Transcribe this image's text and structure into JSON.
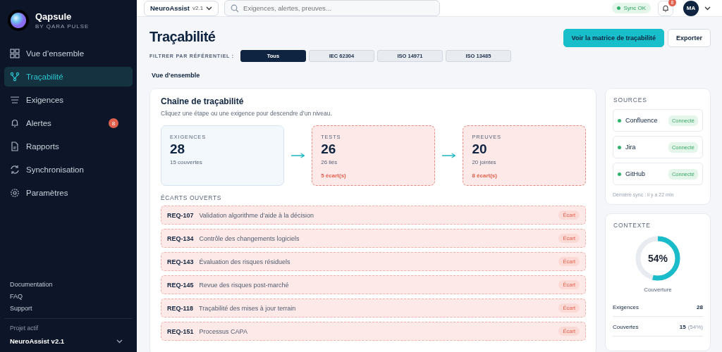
{
  "brand": {
    "name": "Qapsule",
    "tagline": "BY QARA PULSE"
  },
  "sidebar": {
    "items": [
      {
        "label": "Vue d’ensemble",
        "selected": false
      },
      {
        "label": "Traçabilité",
        "selected": true
      },
      {
        "label": "Exigences",
        "selected": false
      },
      {
        "label": "Alertes",
        "selected": false,
        "badge": "8"
      },
      {
        "label": "Rapports",
        "selected": false
      },
      {
        "label": "Synchronisation",
        "selected": false
      },
      {
        "label": "Paramètres",
        "selected": false
      }
    ],
    "links": [
      "Documentation",
      "FAQ",
      "Support"
    ],
    "project": {
      "label": "Projet actif",
      "name": "NeuroAssist v2.1"
    }
  },
  "topbar": {
    "project": {
      "name": "NeuroAssist",
      "version": "v2.1"
    },
    "search": {
      "placeholder": "Exigences, alertes, preuves..."
    },
    "sync": "Sync OK",
    "notifications": "8",
    "avatar": "MA"
  },
  "page": {
    "title": "Traçabilité",
    "filter_label": "FILTRER PAR RÉFÉRENTIEL :",
    "filters": [
      {
        "label": "Tous",
        "selected": true
      },
      {
        "label": "IEC 62304",
        "selected": false
      },
      {
        "label": "ISO 14971",
        "selected": false
      },
      {
        "label": "ISO 13485",
        "selected": false
      }
    ],
    "actions": [
      {
        "label": "Voir la matrice de traçabilité",
        "kind": "primary"
      },
      {
        "label": "Exporter",
        "kind": "secondary"
      }
    ],
    "view_tab": "Vue d’ensemble"
  },
  "chain": {
    "title": "Chaîne de traçabilité",
    "subtitle": "Cliquez une étape ou une exigence pour descendre d’un niveau.",
    "steps": [
      {
        "label": "EXIGENCES",
        "value": "28",
        "detail": "15 couvertes",
        "kind": "ok"
      },
      {
        "label": "TESTS",
        "value": "26",
        "detail": "26 liés",
        "gaps": "5 écart(s)",
        "kind": "gap"
      },
      {
        "label": "PREUVES",
        "value": "20",
        "detail": "20 jointes",
        "gaps": "8 écart(s)",
        "kind": "gap"
      }
    ],
    "gaps_title": "ÉCARTS OUVERTS",
    "gaps": [
      {
        "id": "REQ-107",
        "title": "Validation algorithme d’aide à la décision",
        "status": "Écart"
      },
      {
        "id": "REQ-134",
        "title": "Contrôle des changements logiciels",
        "status": "Écart"
      },
      {
        "id": "REQ-143",
        "title": "Évaluation des risques résiduels",
        "status": "Écart"
      },
      {
        "id": "REQ-145",
        "title": "Revue des risques post-marché",
        "status": "Écart"
      },
      {
        "id": "REQ-118",
        "title": "Traçabilité des mises à jour terrain",
        "status": "Écart"
      },
      {
        "id": "REQ-151",
        "title": "Processus CAPA",
        "status": "Écart"
      }
    ]
  },
  "sources": {
    "title": "SOURCES",
    "items": [
      {
        "name": "Confluence",
        "status": "Connecté",
        "color": "#2fb36b"
      },
      {
        "name": "Jira",
        "status": "Connecté",
        "color": "#2fb36b"
      },
      {
        "name": "GitHub",
        "status": "Connecté",
        "color": "#2fb36b"
      }
    ],
    "last_sync": "Dernière sync : il y a 22 min"
  },
  "context": {
    "title": "CONTEXTE",
    "coverage": {
      "level": 0.54,
      "value": "54%",
      "label": "Couverture"
    },
    "stats": [
      {
        "label": "Exigences",
        "value": "28"
      },
      {
        "label": "Couvertes",
        "value": "15",
        "note": "(54%)"
      }
    ]
  }
}
